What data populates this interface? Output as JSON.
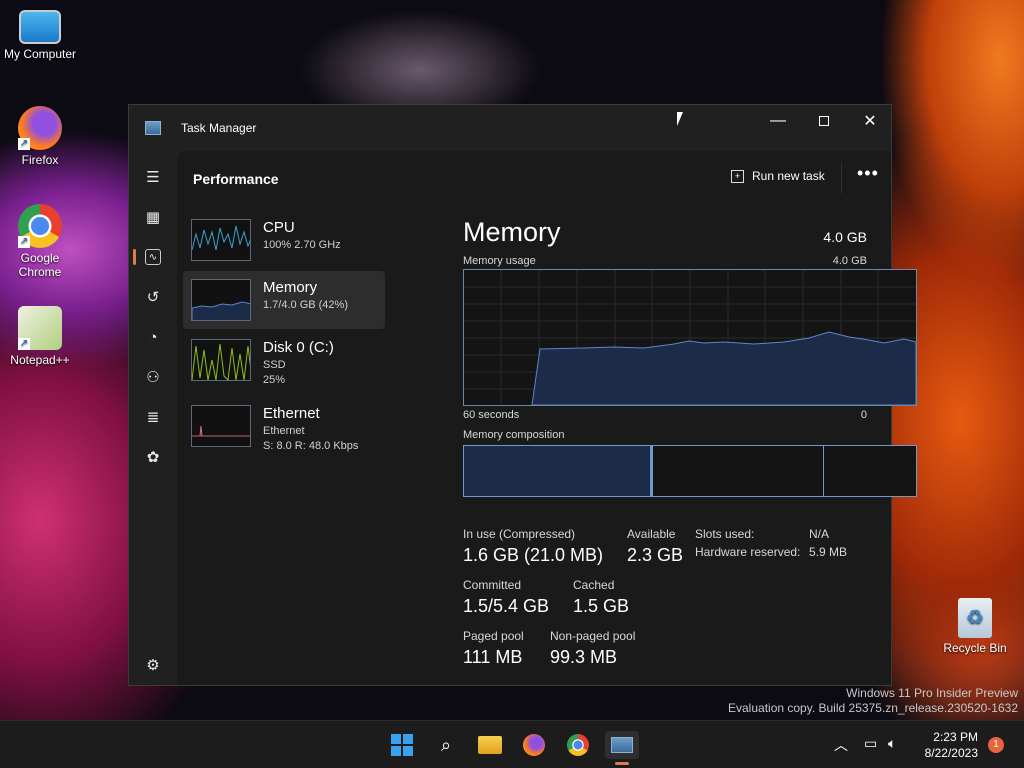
{
  "desktop": {
    "icons": [
      {
        "label": "My Computer"
      },
      {
        "label": "Firefox"
      },
      {
        "label": "Google Chrome"
      },
      {
        "label": "Notepad++"
      },
      {
        "label": "Recycle Bin"
      }
    ],
    "watermark": {
      "line1": "Windows 11 Pro Insider Preview",
      "line2": "Evaluation copy. Build 25375.zn_release.230520-1632"
    }
  },
  "window": {
    "title": "Task Manager",
    "page_title": "Performance",
    "run_new_task": "Run new task",
    "more": "•••"
  },
  "perf_list": [
    {
      "name": "CPU",
      "sub1": "100% 2.70 GHz",
      "sub2": ""
    },
    {
      "name": "Memory",
      "sub1": "1.7/4.0 GB (42%)",
      "sub2": ""
    },
    {
      "name": "Disk 0 (C:)",
      "sub1": "SSD",
      "sub2": "25%"
    },
    {
      "name": "Ethernet",
      "sub1": "Ethernet",
      "sub2": "S: 8.0 R: 48.0 Kbps"
    }
  ],
  "memory": {
    "title": "Memory",
    "total": "4.0 GB",
    "usage_label": "Memory usage",
    "usage_max": "4.0 GB",
    "axis_left": "60 seconds",
    "axis_right": "0",
    "composition_label": "Memory composition",
    "stats": {
      "in_use_label": "In use (Compressed)",
      "in_use_value": "1.6 GB (21.0 MB)",
      "available_label": "Available",
      "available_value": "2.3 GB",
      "slots_label": "Slots used:",
      "slots_value": "N/A",
      "hw_label": "Hardware reserved:",
      "hw_value": "5.9 MB",
      "committed_label": "Committed",
      "committed_value": "1.5/5.4 GB",
      "cached_label": "Cached",
      "cached_value": "1.5 GB",
      "paged_label": "Paged pool",
      "paged_value": "111 MB",
      "nonpaged_label": "Non-paged pool",
      "nonpaged_value": "99.3 MB"
    }
  },
  "taskbar": {
    "time": "2:23 PM",
    "date": "8/22/2023",
    "notifications": "1"
  }
}
